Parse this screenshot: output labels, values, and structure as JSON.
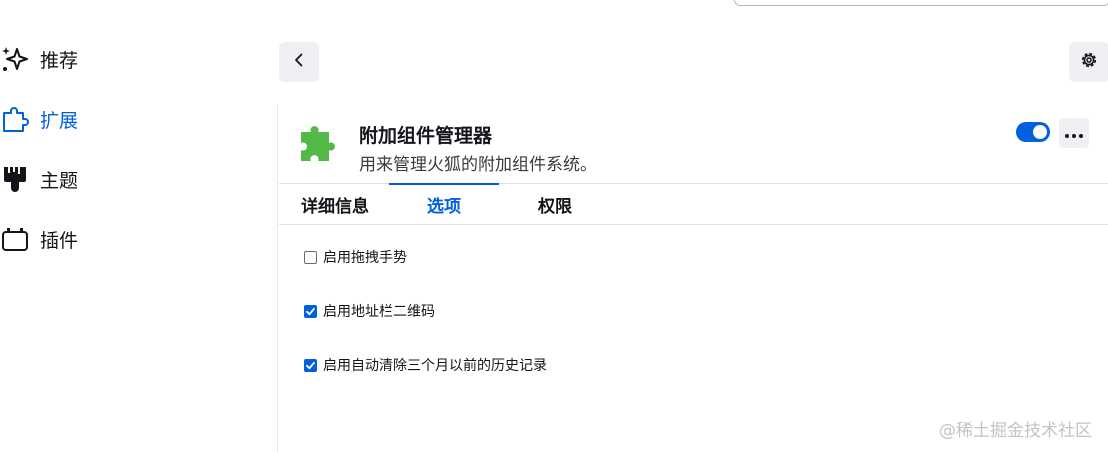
{
  "sidebar": {
    "items": [
      {
        "label": "推荐",
        "icon": "sparkle-icon",
        "active": false
      },
      {
        "label": "扩展",
        "icon": "puzzle-icon",
        "active": true
      },
      {
        "label": "主题",
        "icon": "paintbrush-icon",
        "active": false
      },
      {
        "label": "插件",
        "icon": "plugin-icon",
        "active": false
      }
    ]
  },
  "header": {
    "back_icon": "chevron-left-icon",
    "settings_icon": "gear-icon"
  },
  "addon": {
    "name": "附加组件管理器",
    "description": "用来管理火狐的附加组件系统。",
    "icon": "puzzle-icon",
    "enabled": true,
    "more_icon": "more-icon"
  },
  "tabs": [
    {
      "label": "详细信息",
      "active": false
    },
    {
      "label": "选项",
      "active": true
    },
    {
      "label": "权限",
      "active": false
    }
  ],
  "options": [
    {
      "label": "启用拖拽手势",
      "checked": false
    },
    {
      "label": "启用地址栏二维码",
      "checked": true
    },
    {
      "label": "启用自动清除三个月以前的历史记录",
      "checked": true
    }
  ],
  "watermark": "@稀土掘金技术社区",
  "colors": {
    "accent": "#0061e0",
    "addon_icon": "#54b848"
  }
}
